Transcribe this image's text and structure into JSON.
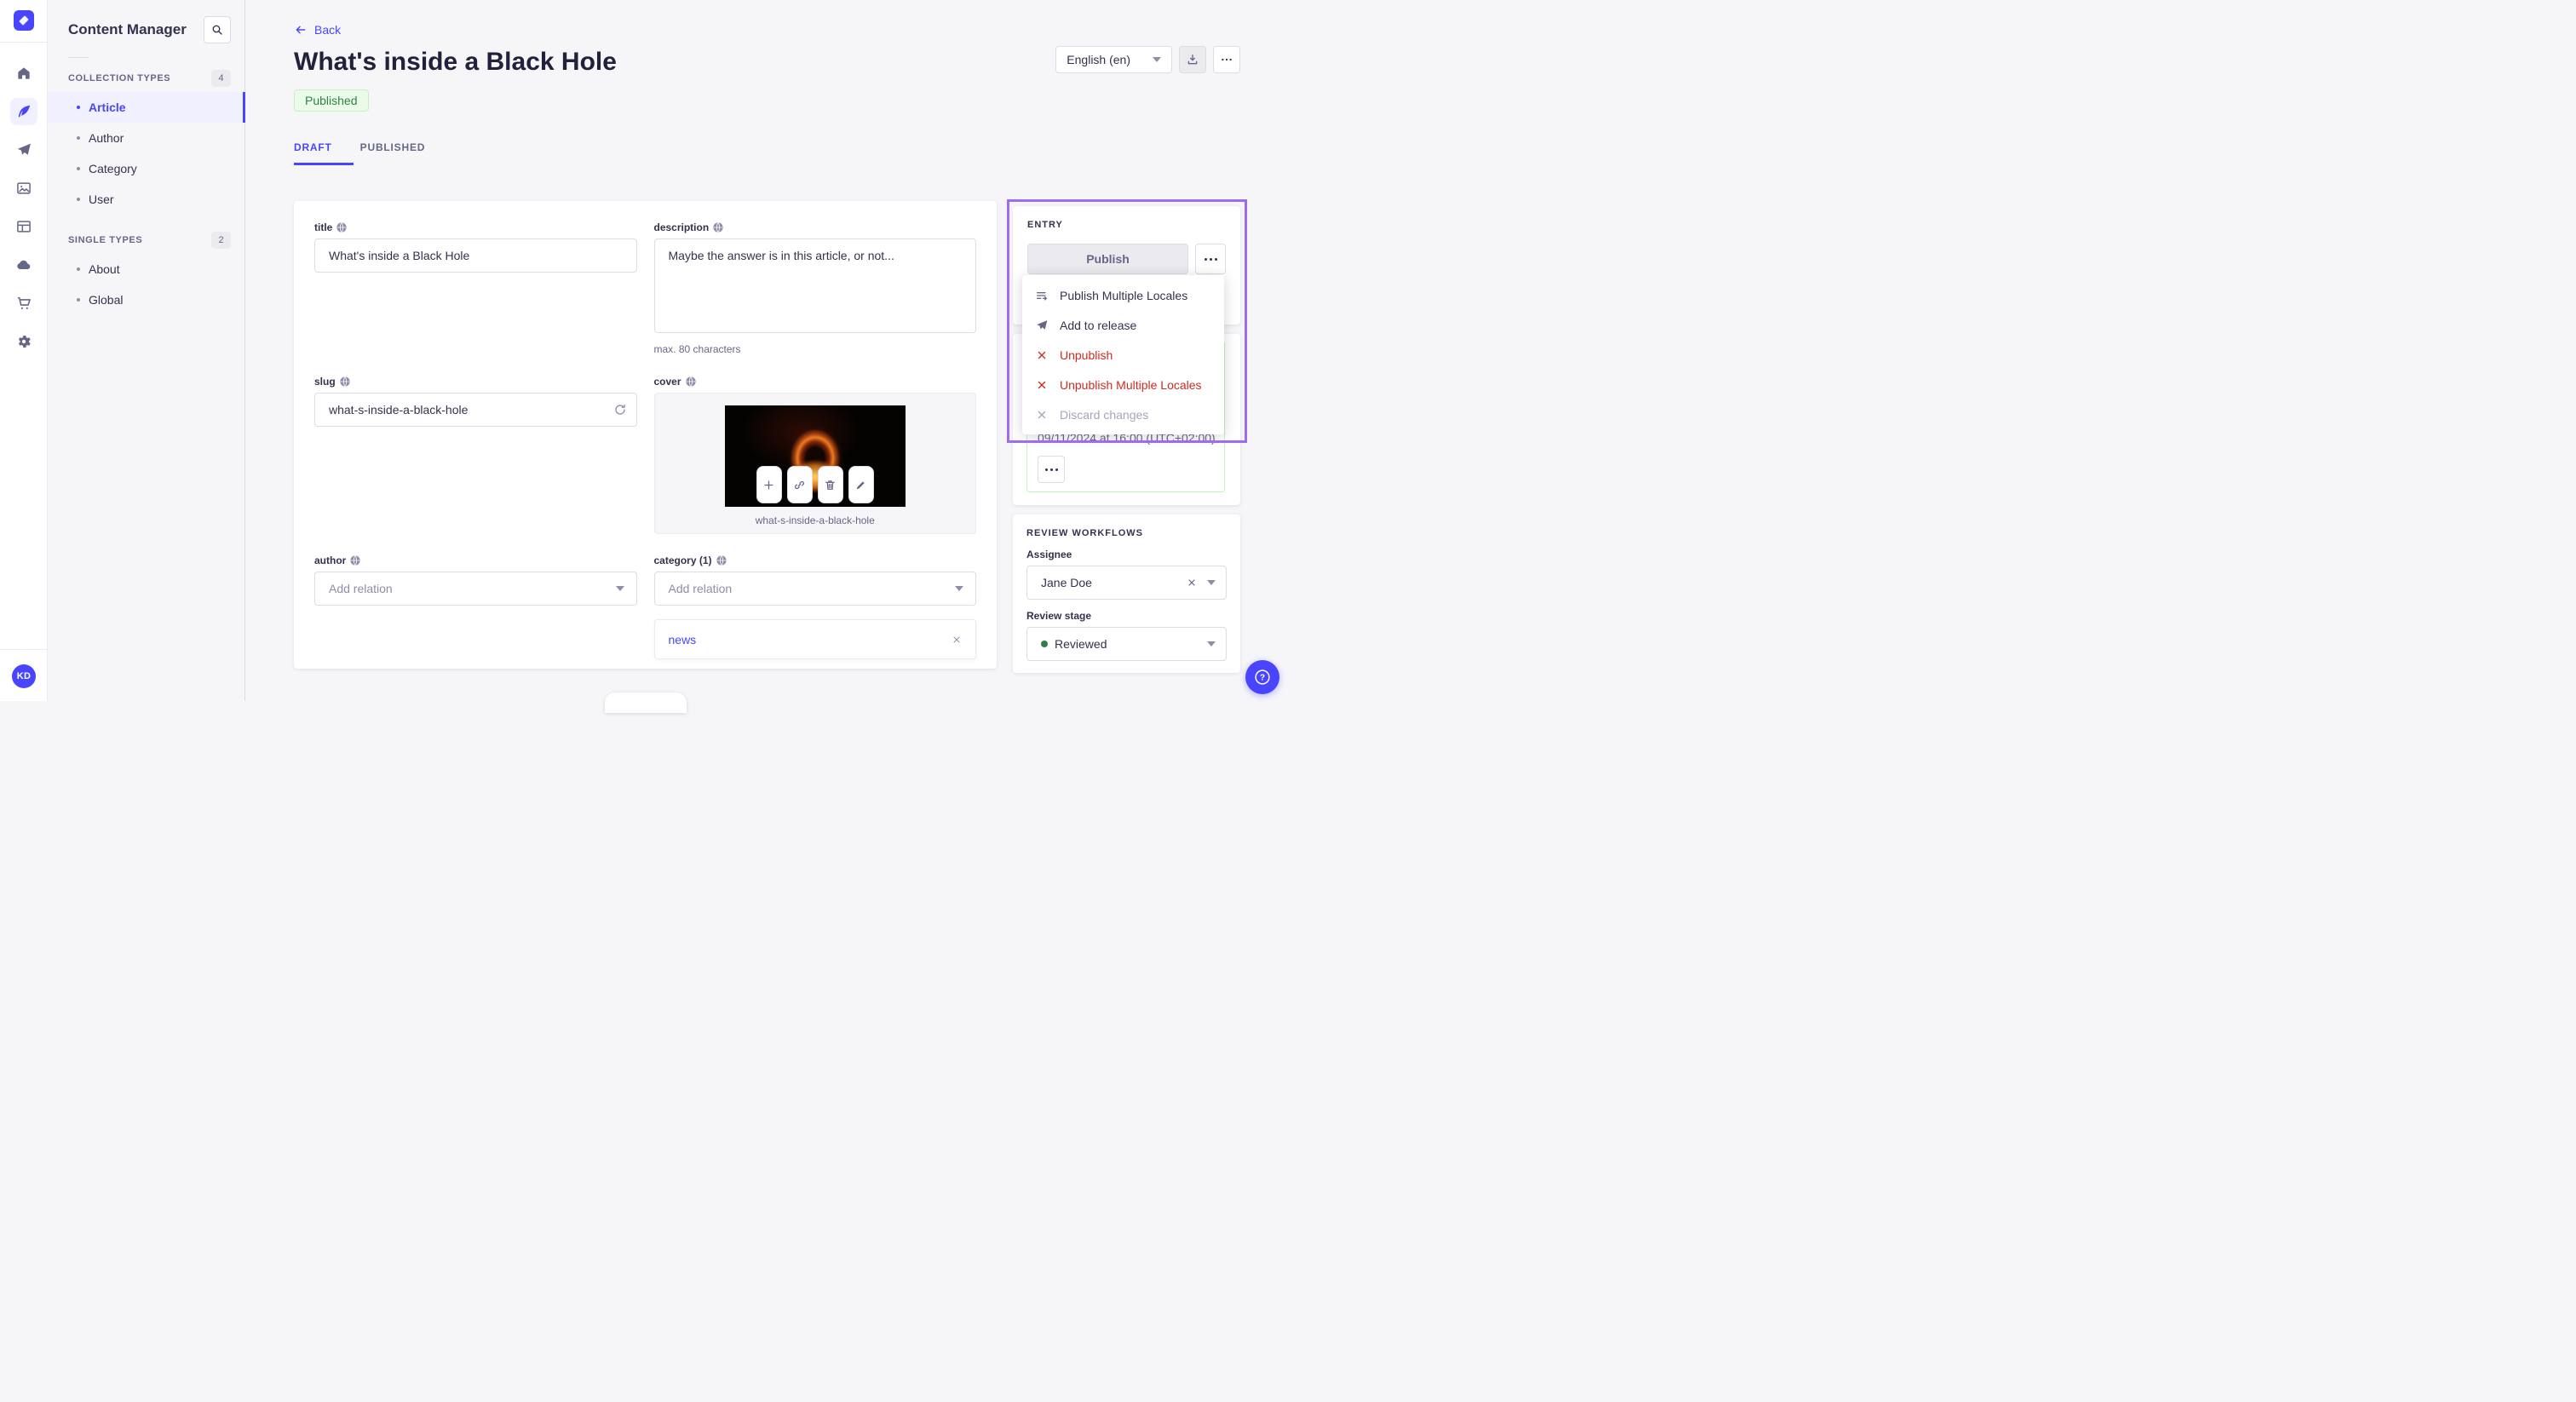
{
  "colors": {
    "accent": "#4945ff",
    "highlight_purple": "#9d6cf0",
    "success_text": "#328048",
    "success_bg": "#eafbe7",
    "success_border": "#c6f0c2",
    "danger": "#d02b20"
  },
  "rail": {
    "items": [
      "home",
      "content-manager",
      "releases",
      "media-library",
      "content-type-builder",
      "deploy",
      "marketplace",
      "settings"
    ],
    "active_item": "content-manager",
    "avatar_initials": "KD"
  },
  "sidebar": {
    "title": "Content Manager",
    "sections": [
      {
        "label": "COLLECTION TYPES",
        "count": "4",
        "items": [
          {
            "label": "Article",
            "active": true
          },
          {
            "label": "Author",
            "active": false
          },
          {
            "label": "Category",
            "active": false
          },
          {
            "label": "User",
            "active": false
          }
        ]
      },
      {
        "label": "SINGLE TYPES",
        "count": "2",
        "items": [
          {
            "label": "About",
            "active": false
          },
          {
            "label": "Global",
            "active": false
          }
        ]
      }
    ]
  },
  "header": {
    "back_label": "Back",
    "title": "What's inside a Black Hole",
    "status_badge": "Published",
    "locale_select": "English (en)"
  },
  "tabs": {
    "draft": "DRAFT",
    "published": "PUBLISHED"
  },
  "form": {
    "title": {
      "label": "title",
      "value": "What's inside a Black Hole"
    },
    "description": {
      "label": "description",
      "value": "Maybe the answer is in this article, or not...",
      "hint": "max. 80 characters"
    },
    "slug": {
      "label": "slug",
      "value": "what-s-inside-a-black-hole"
    },
    "cover": {
      "label": "cover",
      "caption": "what-s-inside-a-black-hole"
    },
    "author": {
      "label": "author",
      "placeholder": "Add relation"
    },
    "category": {
      "label": "category (1)",
      "placeholder": "Add relation",
      "relation": "news"
    }
  },
  "entry_panel": {
    "title": "ENTRY",
    "publish_button": "Publish",
    "release_date": "09/11/2024 at 16:00 (UTC+02:00)",
    "menu": [
      {
        "label": "Publish Multiple Locales",
        "tone": "default",
        "icon": "locales-list-icon"
      },
      {
        "label": "Add to release",
        "tone": "default",
        "icon": "paper-plane-icon"
      },
      {
        "label": "Unpublish",
        "tone": "danger",
        "icon": "cross-icon"
      },
      {
        "label": "Unpublish Multiple Locales",
        "tone": "danger",
        "icon": "cross-icon"
      },
      {
        "label": "Discard changes",
        "tone": "disabled",
        "icon": "cross-icon"
      }
    ]
  },
  "review_panel": {
    "title": "REVIEW WORKFLOWS",
    "assignee_label": "Assignee",
    "assignee_value": "Jane Doe",
    "stage_label": "Review stage",
    "stage_value": "Reviewed"
  }
}
